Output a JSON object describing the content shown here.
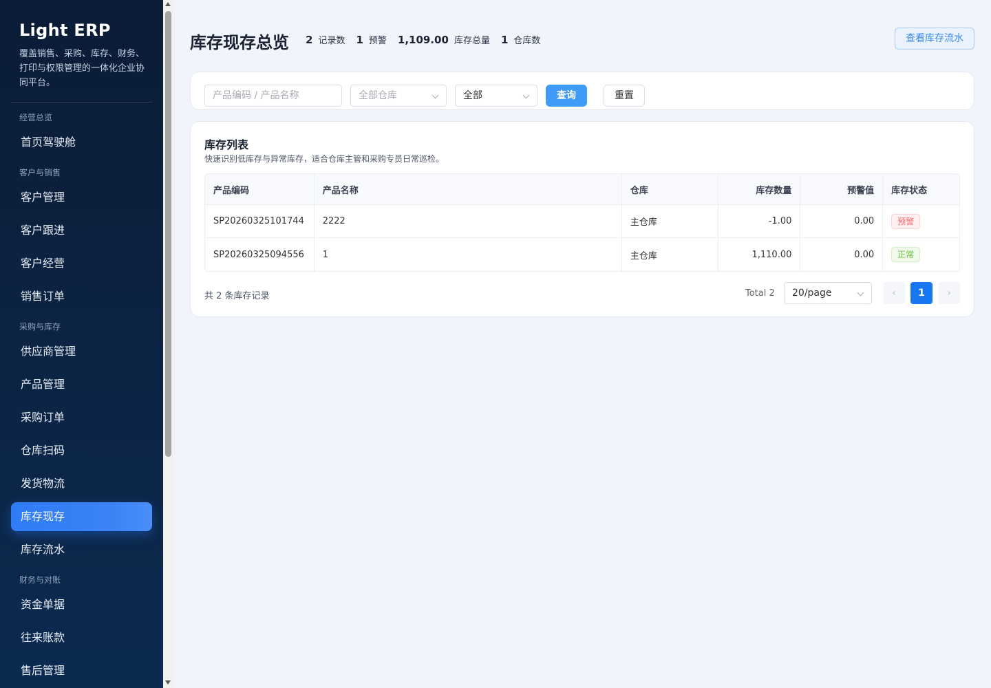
{
  "sidebar": {
    "brand": "Light ERP",
    "description": "覆盖销售、采购、库存、财务、打印与权限管理的一体化企业协同平台。",
    "groups": [
      {
        "label": "经营总览"
      },
      {
        "label": "客户与销售"
      },
      {
        "label": "采购与库存"
      },
      {
        "label": "财务与对账"
      }
    ],
    "items": [
      {
        "label": "首页驾驶舱"
      },
      {
        "label": "客户管理"
      },
      {
        "label": "客户跟进"
      },
      {
        "label": "客户经营"
      },
      {
        "label": "销售订单"
      },
      {
        "label": "供应商管理"
      },
      {
        "label": "产品管理"
      },
      {
        "label": "采购订单"
      },
      {
        "label": "仓库扫码"
      },
      {
        "label": "发货物流"
      },
      {
        "label": "库存现存",
        "active": true
      },
      {
        "label": "库存流水"
      },
      {
        "label": "资金单据"
      },
      {
        "label": "往来账款"
      },
      {
        "label": "售后管理"
      }
    ]
  },
  "header": {
    "title": "库存现存总览",
    "stats": [
      {
        "value": "2",
        "label": "记录数"
      },
      {
        "value": "1",
        "label": "预警"
      },
      {
        "value": "1,109.00",
        "label": "库存总量"
      },
      {
        "value": "1",
        "label": "仓库数"
      }
    ],
    "flow_button": "查看库存流水"
  },
  "filter": {
    "keyword_placeholder": "产品编码 / 产品名称",
    "warehouse_placeholder": "全部仓库",
    "status_value": "全部",
    "query_button": "查询",
    "reset_button": "重置"
  },
  "list": {
    "title": "库存列表",
    "description": "快速识别低库存与异常库存，适合仓库主管和采购专员日常巡检。",
    "columns": [
      "产品编码",
      "产品名称",
      "仓库",
      "库存数量",
      "预警值",
      "库存状态"
    ],
    "rows": [
      {
        "code": "SP20260325101744",
        "name": "2222",
        "warehouse": "主仓库",
        "qty": "-1.00",
        "warn": "0.00",
        "status": "预警"
      },
      {
        "code": "SP20260325094556",
        "name": "1",
        "warehouse": "主仓库",
        "qty": "1,110.00",
        "warn": "0.00",
        "status": "正常"
      }
    ],
    "footer_text": "共 2 条库存记录",
    "total_text": "Total 2",
    "page_size": "20/page",
    "current_page": "1"
  },
  "colors": {
    "accent": "#3f9bf5",
    "active_nav": "#2f7cf6",
    "warn": "#f56c6c",
    "ok": "#67c23a"
  }
}
